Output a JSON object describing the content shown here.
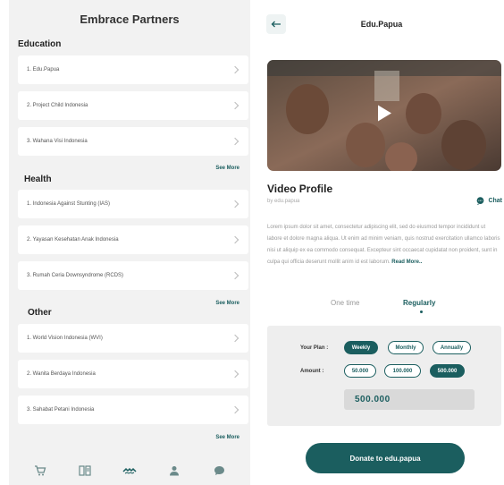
{
  "left": {
    "title": "Embrace Partners",
    "sections": [
      {
        "title": "Education",
        "items": [
          "1. Edu.Papua",
          "2. Project Child Indonesia",
          "3. Wahana Visi Indonesia"
        ],
        "see_more": "See More"
      },
      {
        "title": "Health",
        "items": [
          "1. Indonesia Against Stunting (IAS)",
          "2. Yayasan Kesehatan Anak Indonesia",
          "3. Rumah Ceria Downsyndrome (RCDS)"
        ],
        "see_more": "See More"
      },
      {
        "title": "Other",
        "items": [
          "1. World Vision Indonesia (WVI)",
          "2. Wanita Berdaya Indonesia",
          "3. Sahabat Petani Indonesia"
        ],
        "see_more": "See More"
      }
    ],
    "nav": [
      "cart-icon",
      "book-icon",
      "hands-icon",
      "person-icon",
      "chat-icon"
    ],
    "active_nav_index": 2
  },
  "right": {
    "title": "Edu.Papua",
    "video_title": "Video Profile",
    "by": "by edu.papua",
    "chat_label": "Chat",
    "description": "Lorem ipsum dolor sit amet, consectetur adipiscing elit, sed do eiusmod tempor incididunt ut labore et dolore magna aliqua. Ut enim ad minim veniam, quis nostrud exercitation ullamco laboris nisi ut aliquip ex ea commodo consequat. Excepteur sint occaecat cupidatat non proident, sunt in culpa qui officia deserunt mollit anim id est laborum.",
    "read_more": "Read More..",
    "tabs": {
      "one_time": "One time",
      "regularly": "Regularly",
      "selected": "regularly"
    },
    "plan_label": "Your Plan :",
    "plans": [
      "Weekly",
      "Monthly",
      "Annually"
    ],
    "selected_plan": "Weekly",
    "amount_label": "Amount :",
    "amounts": [
      "50.000",
      "100.000",
      "500.000"
    ],
    "selected_amount": "500.000",
    "amount_value": "500.000",
    "donate_label": "Donate to edu.papua"
  },
  "colors": {
    "accent": "#1b5e5f",
    "bg_gray": "#f2f2f2"
  }
}
